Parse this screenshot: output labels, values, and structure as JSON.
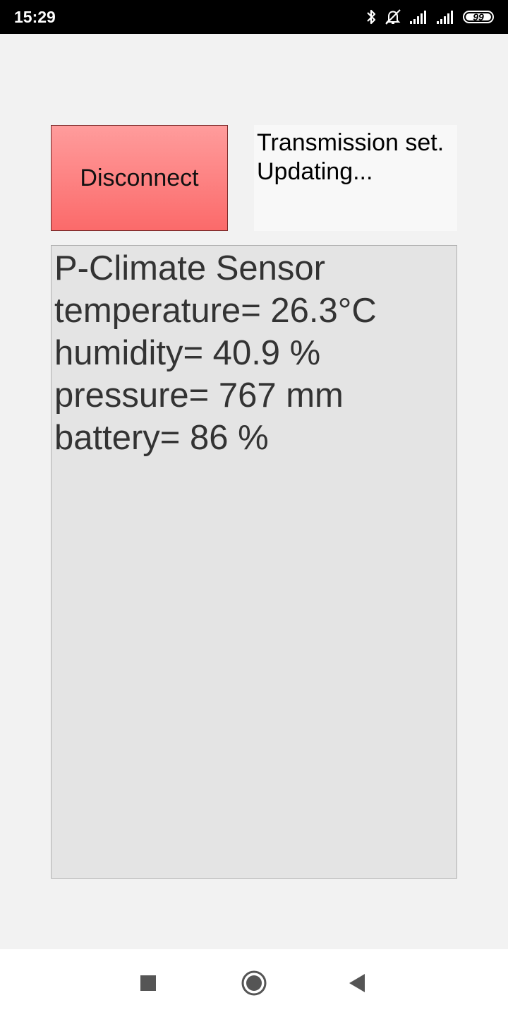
{
  "status_bar": {
    "time": "15:29",
    "battery_level": "99",
    "battery_fraction": 0.99,
    "icons": [
      "bluetooth-icon",
      "bell-off-icon",
      "signal-icon",
      "signal-icon",
      "battery-icon"
    ]
  },
  "controls": {
    "disconnect_label": "Disconnect",
    "status_text": "Transmission set.\nUpdating..."
  },
  "sensor": {
    "lines": [
      "P-Climate Sensor",
      "temperature= 26.3°C",
      "humidity= 40.9 %",
      "pressure= 767 mm",
      "battery= 86 %"
    ]
  },
  "nav_bar": {
    "buttons": [
      "recents-icon",
      "home-icon",
      "back-icon"
    ]
  },
  "colors": {
    "button_top": "#ff9c9c",
    "button_bottom": "#fb6a6a",
    "panel_background": "#e4e4e4",
    "app_background": "#f2f2f2"
  }
}
